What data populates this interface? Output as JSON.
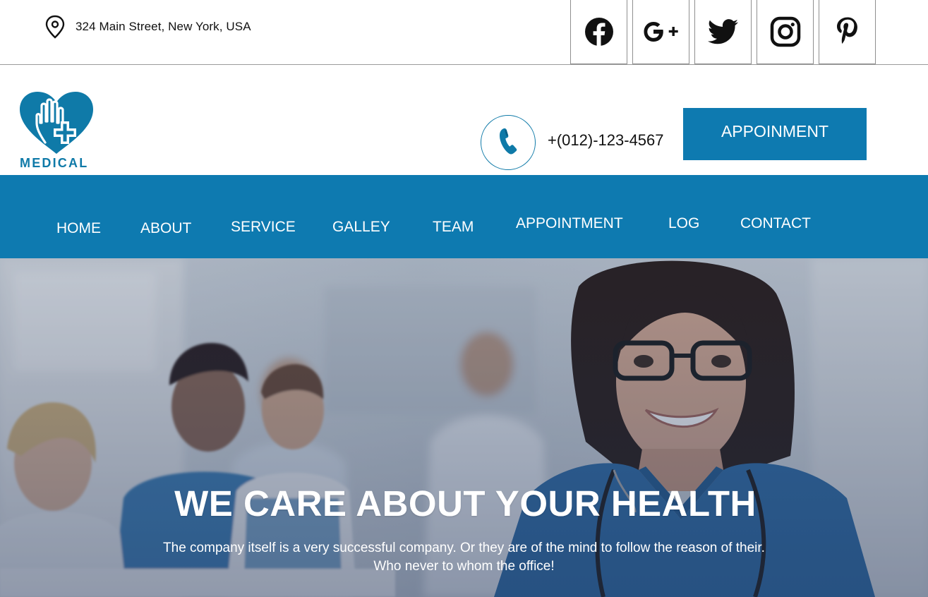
{
  "topbar": {
    "address": "324 Main Street, New York, USA",
    "address_icon": "map-pin-icon",
    "socials": [
      {
        "name": "facebook-icon"
      },
      {
        "name": "google-plus-icon"
      },
      {
        "name": "twitter-icon"
      },
      {
        "name": "instagram-icon"
      },
      {
        "name": "pinterest-icon"
      }
    ]
  },
  "header": {
    "logo_text": "MEDICAL",
    "phone_icon": "phone-icon",
    "phone": "+(012)-123-4567",
    "appointment_button": "APPOINMENT"
  },
  "nav": {
    "items": [
      {
        "label": "HOME"
      },
      {
        "label": "ABOUT"
      },
      {
        "label": "SERVICE"
      },
      {
        "label": "GALLEY"
      },
      {
        "label": "TEAM"
      },
      {
        "label": "APPOINTMENT"
      },
      {
        "label": "LOG"
      },
      {
        "label": "CONTACT"
      }
    ]
  },
  "hero": {
    "title": "WE CARE ABOUT YOUR HEALTH",
    "subtitle_line1": "The company itself is a very successful company. Or they are of the mind to follow the reason of their.",
    "subtitle_line2": "Who never to whom the office!"
  },
  "colors": {
    "brand_blue": "#0e7ab0",
    "text_dark": "#111111",
    "white": "#ffffff"
  }
}
